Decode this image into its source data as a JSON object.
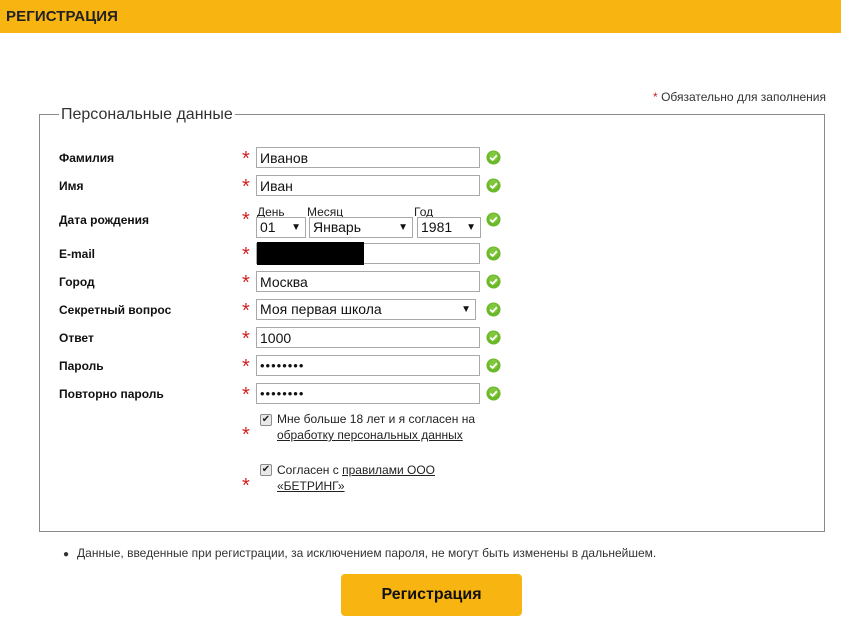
{
  "header": {
    "title": "РЕГИСТРАЦИЯ"
  },
  "required_note": {
    "star": "*",
    "text": "Обязательно для заполнения"
  },
  "section": {
    "legend": "Персональные данные"
  },
  "required_star": "*",
  "fields": {
    "last_name": {
      "label": "Фамилия",
      "value": "Иванов"
    },
    "first_name": {
      "label": "Имя",
      "value": "Иван"
    },
    "birth_date": {
      "label": "Дата рождения",
      "day_label": "День",
      "day_value": "01",
      "month_label": "Месяц",
      "month_value": "Январь",
      "year_label": "Год",
      "year_value": "1981"
    },
    "email": {
      "label": "E-mail",
      "value": ""
    },
    "city": {
      "label": "Город",
      "value": "Москва"
    },
    "secret_question": {
      "label": "Секретный вопрос",
      "value": "Моя первая школа"
    },
    "answer": {
      "label": "Ответ",
      "value": "1000"
    },
    "password": {
      "label": "Пароль",
      "value": "••••••••"
    },
    "password_repeat": {
      "label": "Повторно пароль",
      "value": "••••••••"
    }
  },
  "agreements": {
    "age": {
      "text": "Мне больше 18 лет и я согласен на",
      "link": "обработку персональных данных",
      "checked": true
    },
    "rules": {
      "text": "Согласен с",
      "link": "правилами ООО «БЕТРИНГ»",
      "checked": true
    }
  },
  "note": "Данные, введенные при регистрации, за исключением пароля, не могут быть изменены в дальнейшем.",
  "submit_label": "Регистрация",
  "colors": {
    "accent": "#f8b410",
    "required_star": "#d01f1f",
    "valid_icon": "#6bb82a"
  }
}
